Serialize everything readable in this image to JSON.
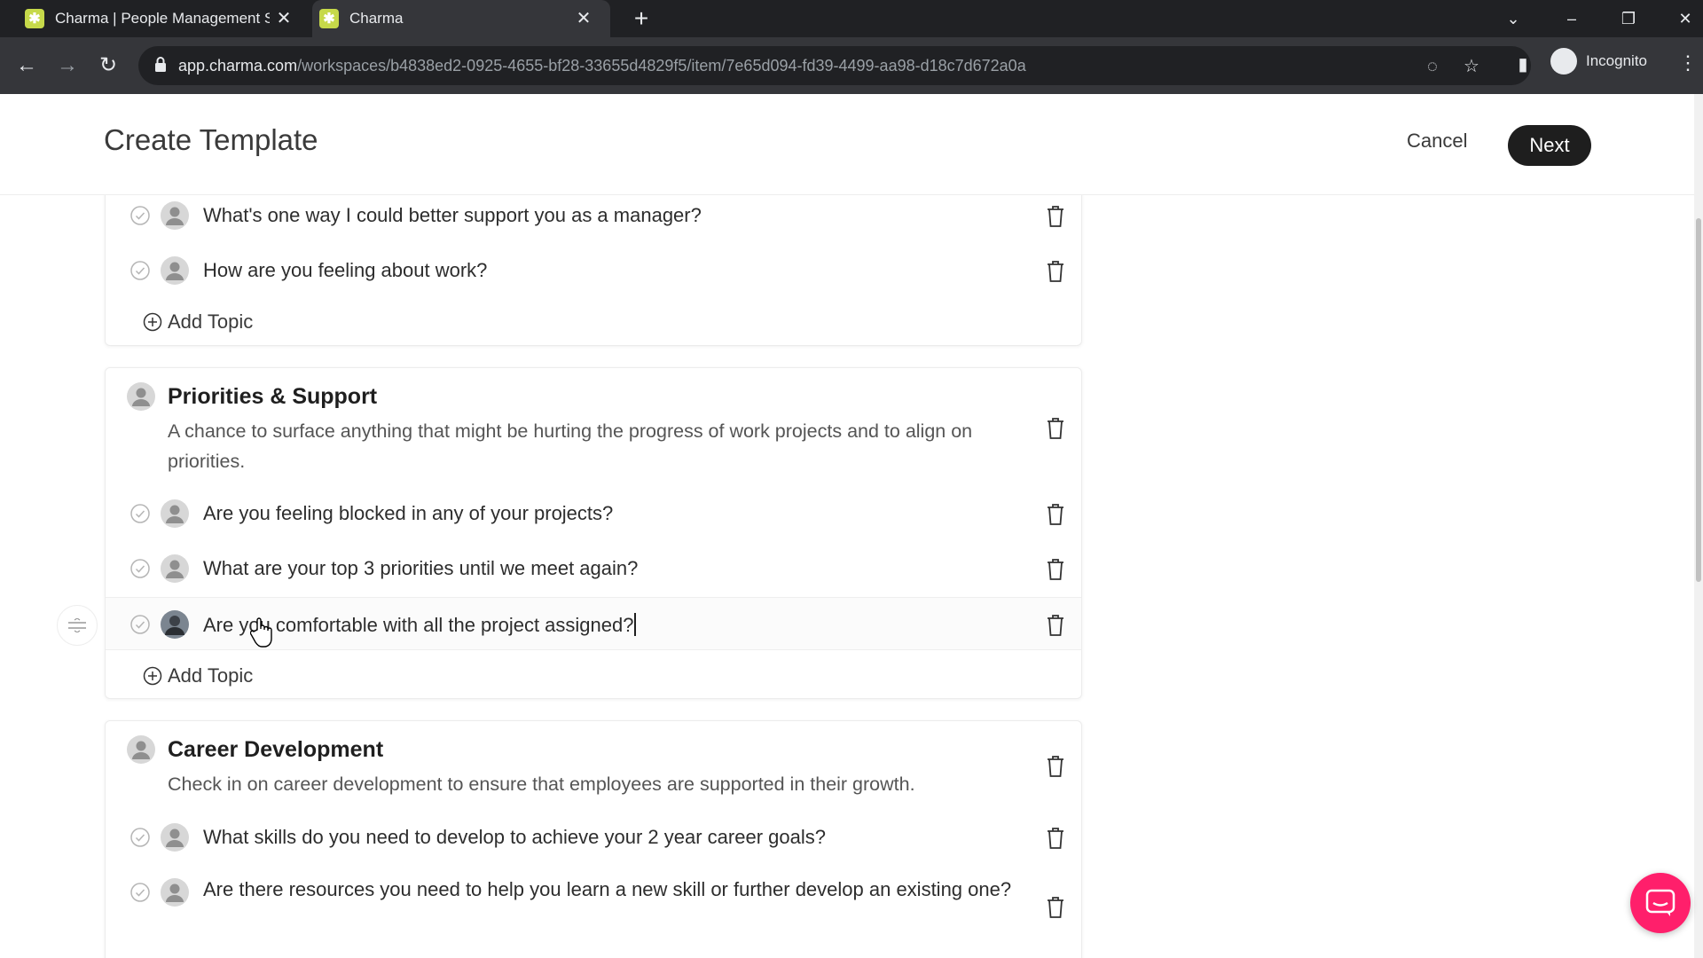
{
  "browser": {
    "tabs": [
      {
        "title": "Charma | People Management S"
      },
      {
        "title": "Charma"
      }
    ],
    "url_host": "app.charma.com",
    "url_path": "/workspaces/b4838ed2-0925-4655-bf28-33655d4829f5/item/7e65d094-fd39-4499-aa98-d18c7d672a0a",
    "profile_label": "Incognito"
  },
  "header": {
    "title": "Create Template",
    "cancel_label": "Cancel",
    "next_label": "Next"
  },
  "sections": [
    {
      "topics": [
        "What's one way I could better support you as a manager?",
        "How are you feeling about work?"
      ],
      "add_topic_label": "Add Topic"
    },
    {
      "title": "Priorities & Support",
      "description": "A chance to surface anything that might be hurting the progress of work projects and to align on priorities.",
      "topics": [
        "Are you feeling blocked in any of your projects?",
        "What are your top 3 priorities until we meet again?",
        "Are you comfortable with all the project assigned?"
      ],
      "add_topic_label": "Add Topic"
    },
    {
      "title": "Career Development",
      "description": "Check in on career development to ensure that employees are supported in their growth.",
      "topics": [
        "What skills do you need to develop to achieve your 2 year career goals?",
        "Are there resources you need to help you learn a new skill or further develop an existing one?"
      ]
    }
  ],
  "colors": {
    "chrome_dark": "#202124",
    "chrome_toolbar": "#35363a",
    "next_button": "#1e1e1e",
    "chat_button": "#ff1f6b",
    "favicon": "#c6d94a"
  }
}
